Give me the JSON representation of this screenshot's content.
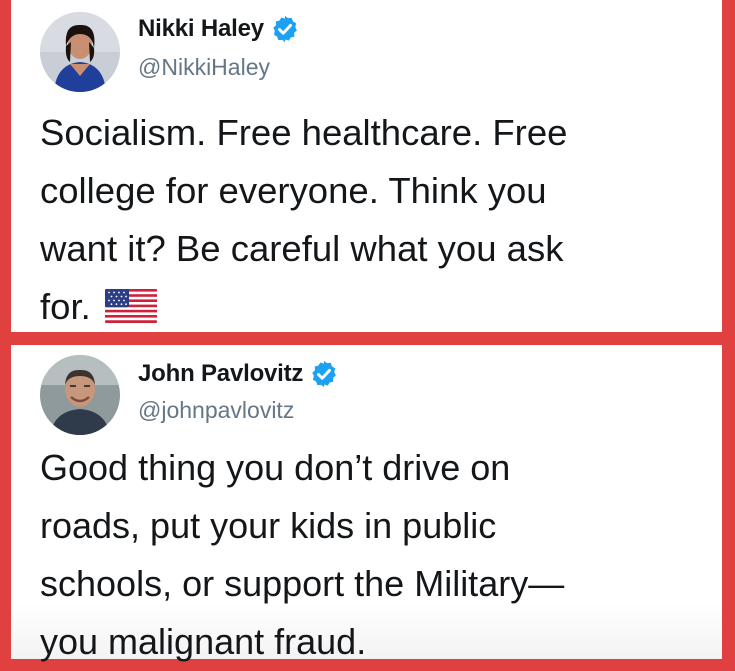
{
  "tweets": [
    {
      "display_name": "Nikki Haley",
      "handle": "@NikkiHaley",
      "verified": true,
      "text": "Socialism. Free healthcare. Free\ncollege for everyone. Think you\nwant it? Be careful what you ask\nfor.",
      "emoji": "us-flag-icon"
    },
    {
      "display_name": "John Pavlovitz",
      "handle": "@johnpavlovitz",
      "verified": true,
      "text": "Good thing you don’t drive on\nroads, put your kids in public\nschools, or support the Military—\nyou malignant fraud."
    }
  ],
  "colors": {
    "frame": "#e0403f",
    "verified": "#1da1f2",
    "handle": "#657786",
    "text": "#14171a"
  }
}
